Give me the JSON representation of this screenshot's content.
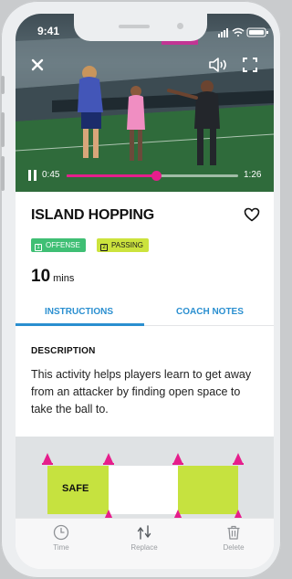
{
  "status_bar": {
    "time": "9:41"
  },
  "video": {
    "current_time": "0:45",
    "duration": "1:26",
    "progress": 0.52
  },
  "activity": {
    "title": "ISLAND HOPPING",
    "tags": [
      {
        "label": "OFFENSE",
        "icon": "1",
        "color": "#3fbf74"
      },
      {
        "label": "PASSING",
        "icon": "2",
        "color": "#cce33d"
      }
    ],
    "duration_value": "10",
    "duration_unit": "mins"
  },
  "tabs": [
    {
      "label": "INSTRUCTIONS",
      "active": true
    },
    {
      "label": "COACH NOTES",
      "active": false
    }
  ],
  "description": {
    "heading": "DESCRIPTION",
    "body": "This activity helps players learn to get away from an attacker by finding open space to take the ball to."
  },
  "diagram": {
    "zone_label": "SAFE"
  },
  "bottom_bar": [
    {
      "label": "Time",
      "icon": "clock-icon"
    },
    {
      "label": "Replace",
      "icon": "replace-icon"
    },
    {
      "label": "Delete",
      "icon": "trash-icon"
    }
  ],
  "colors": {
    "accent": "#2a8fd0",
    "progress": "#e61e8c",
    "zone": "#c6e23f",
    "cone": "#e61e8c"
  }
}
